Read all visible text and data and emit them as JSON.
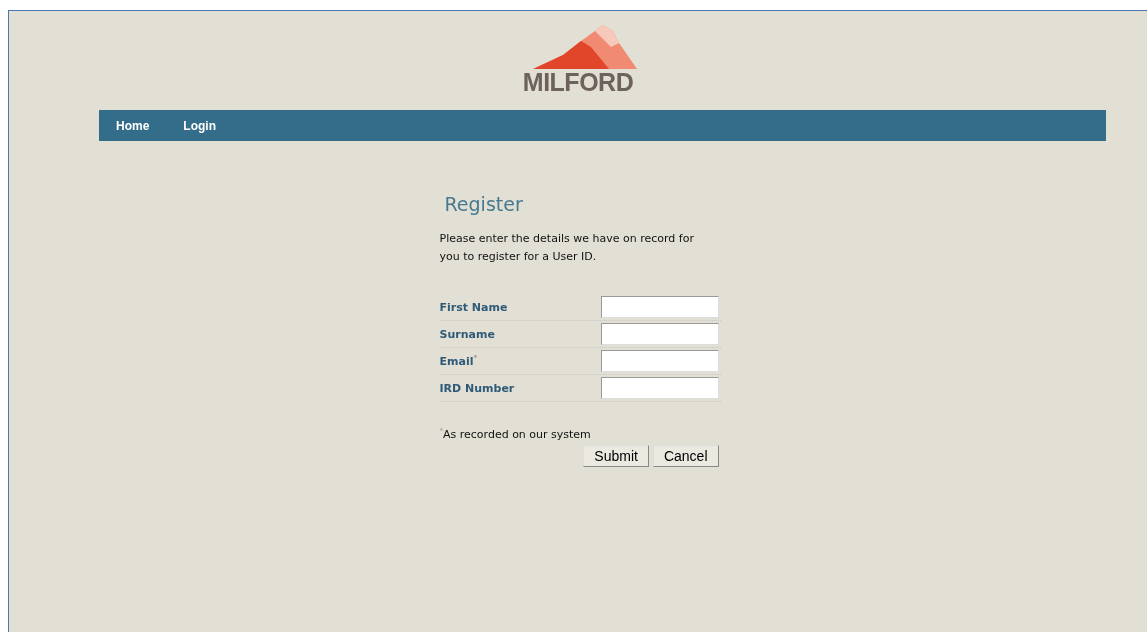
{
  "logo": {
    "text": "MILFORD"
  },
  "nav": [
    {
      "label": "Home"
    },
    {
      "label": "Login"
    }
  ],
  "form": {
    "title": "Register",
    "intro": "Please enter the details we have on record for you to register for a User ID.",
    "fields": [
      {
        "label": "First Name"
      },
      {
        "label": "Surname"
      },
      {
        "label": "Email$^{*}$"
      },
      {
        "label": "IRD Number"
      }
    ],
    "footnote": "$^{*}$As recorded on our system",
    "buttons": [
      "Submit",
      "Cancel"
    ]
  }
}
